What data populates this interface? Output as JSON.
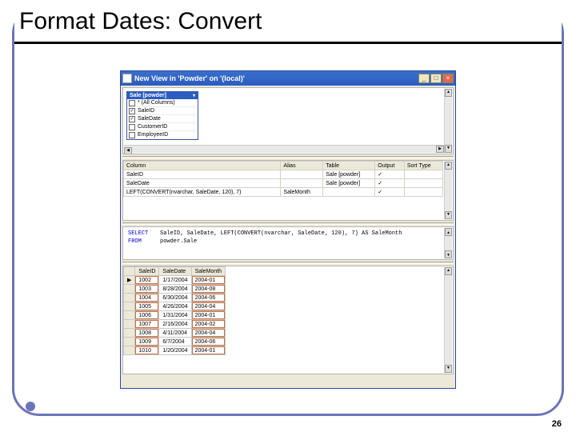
{
  "slide": {
    "title": "Format Dates: Convert",
    "number": "26"
  },
  "window": {
    "title": "New View in 'Powder' on '(local)'",
    "btns": {
      "min": "_",
      "max": "□",
      "close": "×"
    }
  },
  "diagram": {
    "table_name": "Sale [powder]",
    "columns": [
      {
        "name": "* (All Columns)",
        "checked": false
      },
      {
        "name": "SaleID",
        "checked": true
      },
      {
        "name": "SaleDate",
        "checked": true
      },
      {
        "name": "CustomerID",
        "checked": false
      },
      {
        "name": "EmployeeID",
        "checked": false
      }
    ]
  },
  "grid": {
    "headers": [
      "Column",
      "Alias",
      "Table",
      "Output",
      "Sort Type"
    ],
    "rows": [
      {
        "column": "SaleID",
        "alias": "",
        "table": "Sale [powder]",
        "output": "✓",
        "sort": ""
      },
      {
        "column": "SaleDate",
        "alias": "",
        "table": "Sale [powder]",
        "output": "✓",
        "sort": ""
      },
      {
        "column": "LEFT(CONVERT(nvarchar, SaleDate, 120), 7)",
        "alias": "SaleMonth",
        "table": "",
        "output": "✓",
        "sort": ""
      }
    ]
  },
  "sql": {
    "select_kw": "SELECT",
    "select_body": "SaleID, SaleDate, LEFT(CONVERT(nvarchar, SaleDate, 120), 7) AS SaleMonth",
    "from_kw": "FROM",
    "from_body": "powder.Sale"
  },
  "results": {
    "headers": [
      "SaleID",
      "SaleDate",
      "SaleMonth"
    ],
    "rows": [
      {
        "id": "1002",
        "date": "1/17/2004",
        "month": "2004-01"
      },
      {
        "id": "1003",
        "date": "8/28/2004",
        "month": "2004-08"
      },
      {
        "id": "1004",
        "date": "6/30/2004",
        "month": "2004-06"
      },
      {
        "id": "1005",
        "date": "4/26/2004",
        "month": "2004-04"
      },
      {
        "id": "1006",
        "date": "1/31/2004",
        "month": "2004-01"
      },
      {
        "id": "1007",
        "date": "2/16/2004",
        "month": "2004-02"
      },
      {
        "id": "1008",
        "date": "4/11/2004",
        "month": "2004-04"
      },
      {
        "id": "1009",
        "date": "6/7/2004",
        "month": "2004-06"
      },
      {
        "id": "1010",
        "date": "1/20/2004",
        "month": "2004-01"
      }
    ]
  }
}
